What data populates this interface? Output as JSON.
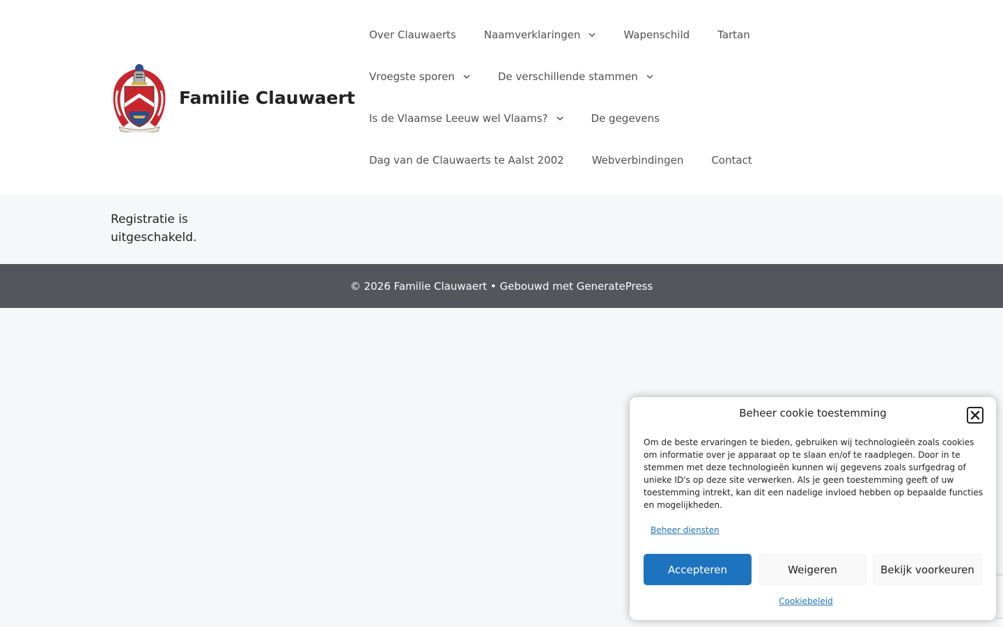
{
  "header": {
    "site_title": "Familie Clauwaert",
    "logo": "family-coat-of-arms-logo"
  },
  "nav": {
    "rows": [
      [
        {
          "label": "Over Clauwaerts",
          "dropdown": false
        },
        {
          "label": "Naamverklaringen",
          "dropdown": true
        },
        {
          "label": "Wapenschild",
          "dropdown": false
        },
        {
          "label": "Tartan",
          "dropdown": false
        }
      ],
      [
        {
          "label": "Vroegste sporen",
          "dropdown": true
        },
        {
          "label": "De verschillende stammen",
          "dropdown": true
        }
      ],
      [
        {
          "label": "Is de Vlaamse Leeuw wel Vlaams?",
          "dropdown": true
        },
        {
          "label": "De gegevens",
          "dropdown": false
        }
      ],
      [
        {
          "label": "Dag van de Clauwaerts te Aalst 2002",
          "dropdown": false
        },
        {
          "label": "Webverbindingen",
          "dropdown": false
        },
        {
          "label": "Contact",
          "dropdown": false
        }
      ]
    ]
  },
  "content": {
    "message": "Registratie is uitgeschakeld."
  },
  "footer": {
    "copyright": "© 2026 Familie Clauwaert",
    "separator": " • ",
    "built_with": "Gebouwd met ",
    "theme_link": "GeneratePress"
  },
  "cookie": {
    "title": "Beheer cookie toestemming",
    "message": "Om de beste ervaringen te bieden, gebruiken wij technologieën zoals cookies om informatie over je apparaat op te slaan en/of te raadplegen. Door in te stemmen met deze technologieën kunnen wij gegevens zoals surfgedrag of unieke ID's op deze site verwerken. Als je geen toestemming geeft of uw toestemming intrekt, kan dit een nadelige invloed hebben op bepaalde functies en mogelijkheden.",
    "manage_services": "Beheer diensten",
    "accept": "Accepteren",
    "deny": "Weigeren",
    "preferences": "Bekijk voorkeuren",
    "policy": "Cookiebeleid"
  },
  "colors": {
    "accent": "#1e73be",
    "footer_bg": "#55555e",
    "page_bg": "#f6f7f9"
  }
}
